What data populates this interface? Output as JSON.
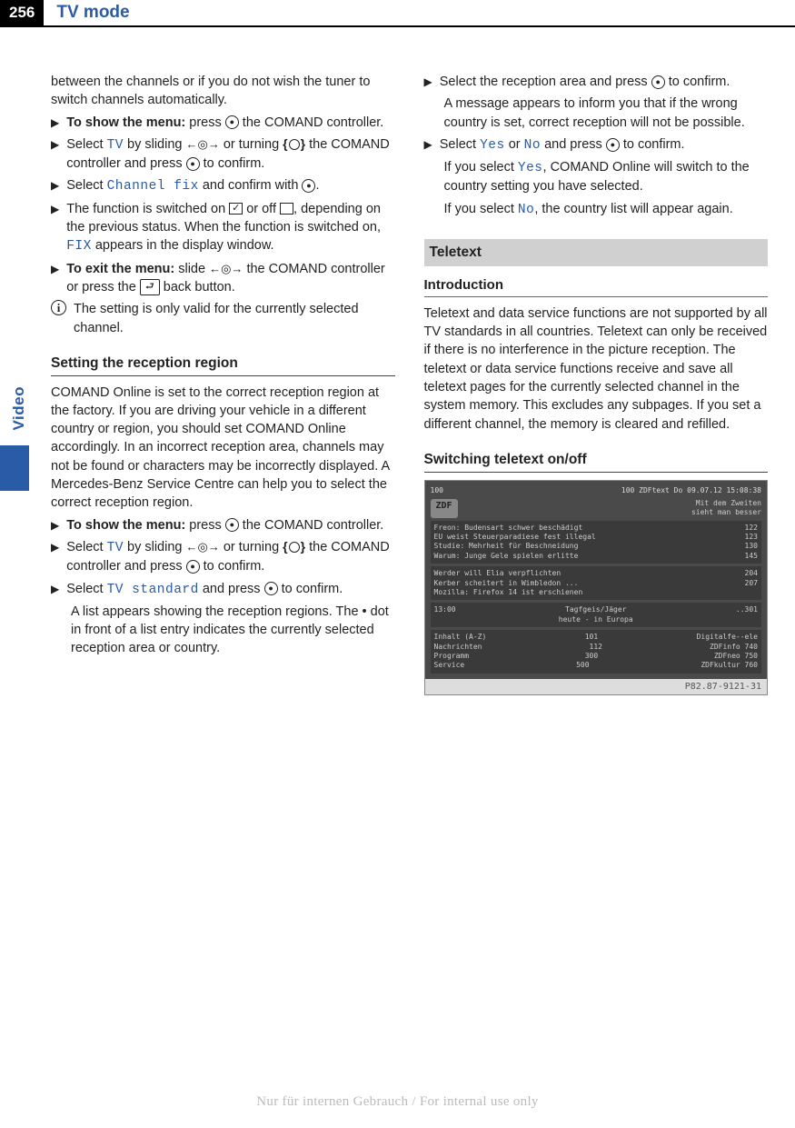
{
  "page_number": "256",
  "header_title": "TV mode",
  "side_label": "Video",
  "col1": {
    "intro": "between the channels or if you do not wish the tuner to switch channels automatically.",
    "s1a": "To show the menu:",
    "s1b": " press ",
    "s1c": " the COMAND controller.",
    "s2a": "Select ",
    "s2_tv": "TV",
    "s2b": " by sliding ",
    "s2c": " or turning ",
    "s2d": " the COMAND controller and press ",
    "s2e": " to confirm.",
    "s3a": "Select ",
    "s3_cf": "Channel fix",
    "s3b": " and confirm with ",
    "s3c": ".",
    "s4a": "The function is switched on ",
    "s4b": " or off ",
    "s4c": ", depending on the previous status. When the function is switched on, ",
    "s4_fix": "FIX",
    "s4d": " appears in the display window.",
    "s5a": "To exit the menu:",
    "s5b": " slide ",
    "s5c": " the COMAND controller or press the ",
    "s5d": " back button.",
    "info1": "The setting is only valid for the currently selected channel.",
    "h_region": "Setting the reception region",
    "region_p": "COMAND Online is set to the correct reception region at the factory. If you are driving your vehicle in a different country or region, you should set COMAND Online accordingly. In an incorrect reception area, channels may not be found or characters may be incorrectly displayed. A Mercedes-Benz Service Centre can help you to select the correct reception region.",
    "r1a": "To show the menu:",
    "r1b": " press ",
    "r1c": " the COMAND controller.",
    "r2a": "Select ",
    "r2_tv": "TV",
    "r2b": " by sliding ",
    "r2c": " or turning ",
    "r2d": " the COMAND controller and press ",
    "r2e": " to confirm.",
    "r3a": "Select ",
    "r3_tvs": "TV standard",
    "r3b": " and press ",
    "r3c": " to confirm.",
    "r3_p": "A list appears showing the reception regions. The • dot in front of a list entry indicates the currently selected reception area or country."
  },
  "col2": {
    "c1a": "Select the reception area and press ",
    "c1b": " to confirm.",
    "c1_p": "A message appears to inform you that if the wrong country is set, correct reception will not be possible.",
    "c2a": "Select ",
    "c2_yes": "Yes",
    "c2b": " or ",
    "c2_no": "No",
    "c2c": " and press ",
    "c2d": " to confirm.",
    "c2_p1a": "If you select ",
    "c2_p1b": ", COMAND Online will switch to the country setting you have selected.",
    "c2_p2a": "If you select ",
    "c2_p2b": ", the country list will appear again.",
    "h_teletext": "Teletext",
    "h_intro": "Introduction",
    "intro_p": "Teletext and data service functions are not supported by all TV standards in all countries. Teletext can only be received if there is no interference in the picture reception. The teletext or data service functions receive and save all teletext pages for the currently selected channel in the system memory. This excludes any subpages. If you set a different channel, the memory is cleared and refilled.",
    "h_switch": "Switching teletext on/off",
    "img": {
      "topleft": "100",
      "topmid": "100  ZDFtext  Do 09.07.12 15:08:38",
      "logo": "ZDF",
      "tagline1": "Mit dem Zweiten",
      "tagline2": "sieht man besser",
      "b1r1l": "Freon: Budensart schwer beschädigt",
      "b1r1r": "122",
      "b1r2l": "EU weist Steuerparadiese fest illegal",
      "b1r2r": "123",
      "b1r3l": "Studie: Mehrheit für Beschneidung",
      "b1r3r": "130",
      "b1r4l": "Warum: Junge Gele spielen erlitte",
      "b1r4r": "145",
      "b2r1l": "Werder will Elia verpflichten",
      "b2r1r": "204",
      "b2r2l": "Kerber scheitert in Wimbledon ...",
      "b2r2r": "207",
      "b2r3l": "Mozilla: Firefox 14 ist erschienen",
      "b2r3r": "",
      "b3l": "13:00",
      "b3m": "Tagfgeis/Jäger",
      "b3r": "..301",
      "b3b": "heute - in Europa",
      "b4r1l": "Inhalt (A-Z)",
      "b4r1m": "101",
      "b4r1r": "Digitalfe--ele",
      "b4r2l": "Nachrichten",
      "b4r2m": "112",
      "b4r2r": "ZDFinfo     740",
      "b4r3l": "Programm",
      "b4r3m": "300",
      "b4r3r": "ZDFneo      750",
      "b4r4l": "Service",
      "b4r4m": "500",
      "b4r4r": "ZDFkultur   760",
      "caption": "P82.87-9121-31"
    }
  },
  "footer": "Nur für internen Gebrauch / For internal use only",
  "triangle": "▶",
  "back_glyph": "⮐"
}
